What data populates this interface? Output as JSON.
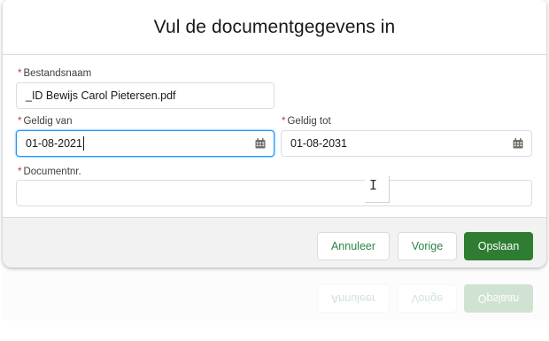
{
  "dialog": {
    "title": "Vul de documentgegevens in"
  },
  "fields": {
    "filename": {
      "label": "Bestandsnaam",
      "value": "_ID Bewijs Carol Pietersen.pdf",
      "required": true
    },
    "valid_from": {
      "label": "Geldig van",
      "value": "01-08-2021",
      "required": true,
      "icon": "calendar-icon"
    },
    "valid_to": {
      "label": "Geldig tot",
      "value": "01-08-2031",
      "required": true,
      "icon": "calendar-icon"
    },
    "document_number": {
      "label": "Documentnr.",
      "value": "",
      "required": true
    }
  },
  "footer": {
    "cancel_label": "Annuleer",
    "back_label": "Vorige",
    "save_label": "Opslaan"
  },
  "colors": {
    "brand": "#2e7d32",
    "focus_border": "#1b96ff",
    "required": "#c23934"
  }
}
